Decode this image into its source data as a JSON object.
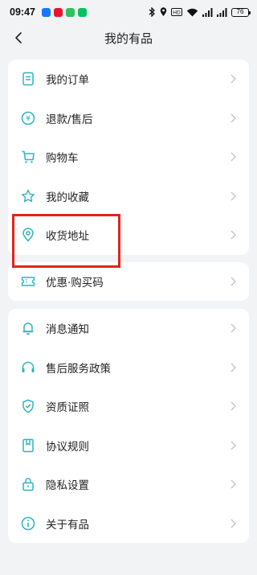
{
  "status_bar": {
    "time": "09:47",
    "battery": "76"
  },
  "header": {
    "title": "我的有品"
  },
  "sections": {
    "orders": [
      {
        "label": "我的订单",
        "icon": "order-list-icon"
      },
      {
        "label": "退款/售后",
        "icon": "refund-icon"
      },
      {
        "label": "购物车",
        "icon": "cart-icon"
      },
      {
        "label": "我的收藏",
        "icon": "star-icon"
      },
      {
        "label": "收货地址",
        "icon": "location-pin-icon"
      }
    ],
    "coupons": [
      {
        "label": "优惠·购买码",
        "icon": "ticket-icon"
      }
    ],
    "settings": [
      {
        "label": "消息通知",
        "icon": "bell-icon"
      },
      {
        "label": "售后服务政策",
        "icon": "headset-icon"
      },
      {
        "label": "资质证照",
        "icon": "shield-check-icon"
      },
      {
        "label": "协议规则",
        "icon": "bookmark-icon"
      },
      {
        "label": "隐私设置",
        "icon": "lock-icon"
      },
      {
        "label": "关于有品",
        "icon": "info-icon"
      }
    ]
  },
  "colors": {
    "accent_icon": "#2bb5bf",
    "highlight": "#e3231b",
    "background": "#f2f3f5"
  }
}
